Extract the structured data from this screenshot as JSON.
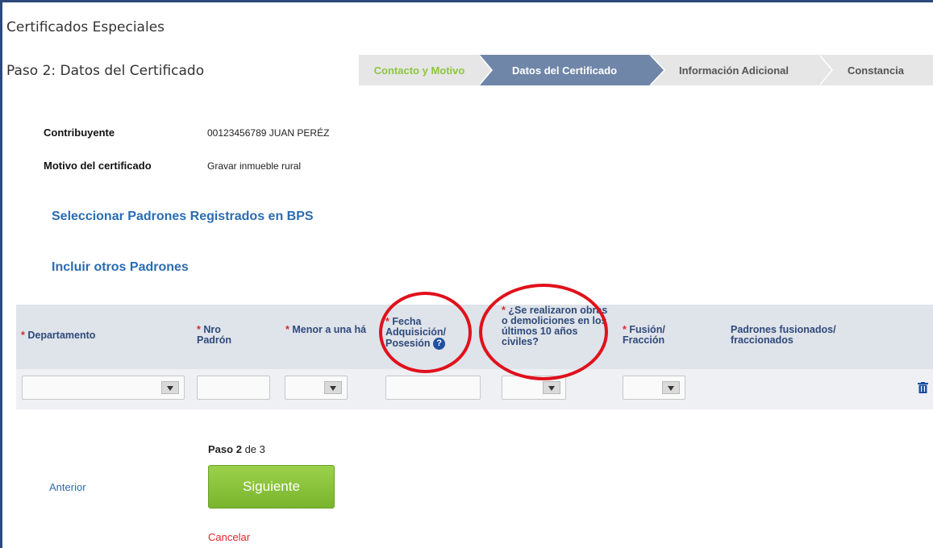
{
  "page": {
    "title": "Certificados Especiales",
    "step_prefix": "Paso 2:",
    "step_name": "Datos del Certificado"
  },
  "wizard": {
    "steps": [
      {
        "label": "Contacto y Motivo",
        "state": "completed"
      },
      {
        "label": "Datos del Certificado",
        "state": "active"
      },
      {
        "label": "Información Adicional",
        "state": "pending"
      },
      {
        "label": "Constancia",
        "state": "pending"
      }
    ]
  },
  "info": {
    "contribuyente_label": "Contribuyente",
    "contribuyente_value": "00123456789 JUAN PERÉZ",
    "motivo_label": "Motivo del certificado",
    "motivo_value": "Gravar inmueble rural"
  },
  "links": {
    "padrones_registrados": "Seleccionar Padrones Registrados en BPS",
    "otros_padrones": "Incluir otros Padrones"
  },
  "table": {
    "required_mark": "*",
    "columns": {
      "departamento": "Departamento",
      "nro_padron": "Nro Padrón",
      "menor_ha": "Menor a una há",
      "fecha_adq": "Fecha Adquisición/ Posesión",
      "obras": "¿Se realizaron obras o demoliciones en los últimos 10 años civiles?",
      "fusion": "Fusión/ Fracción",
      "fusionados": "Padrones fusionados/ fraccionados"
    },
    "help_icon": "?"
  },
  "footer": {
    "paso": "Paso",
    "paso_num": "2",
    "de": "de 3",
    "prev": "Anterior",
    "next": "Siguiente",
    "cancel": "Cancelar"
  },
  "colors": {
    "accent_blue": "#6f86a8",
    "link_blue": "#2b6cb0",
    "green": "#8dc63f",
    "red": "#e0262a",
    "annotation_circle": "#e0111b"
  },
  "icons": [
    "help-icon",
    "trash-icon",
    "dropdown-arrow-icon"
  ]
}
